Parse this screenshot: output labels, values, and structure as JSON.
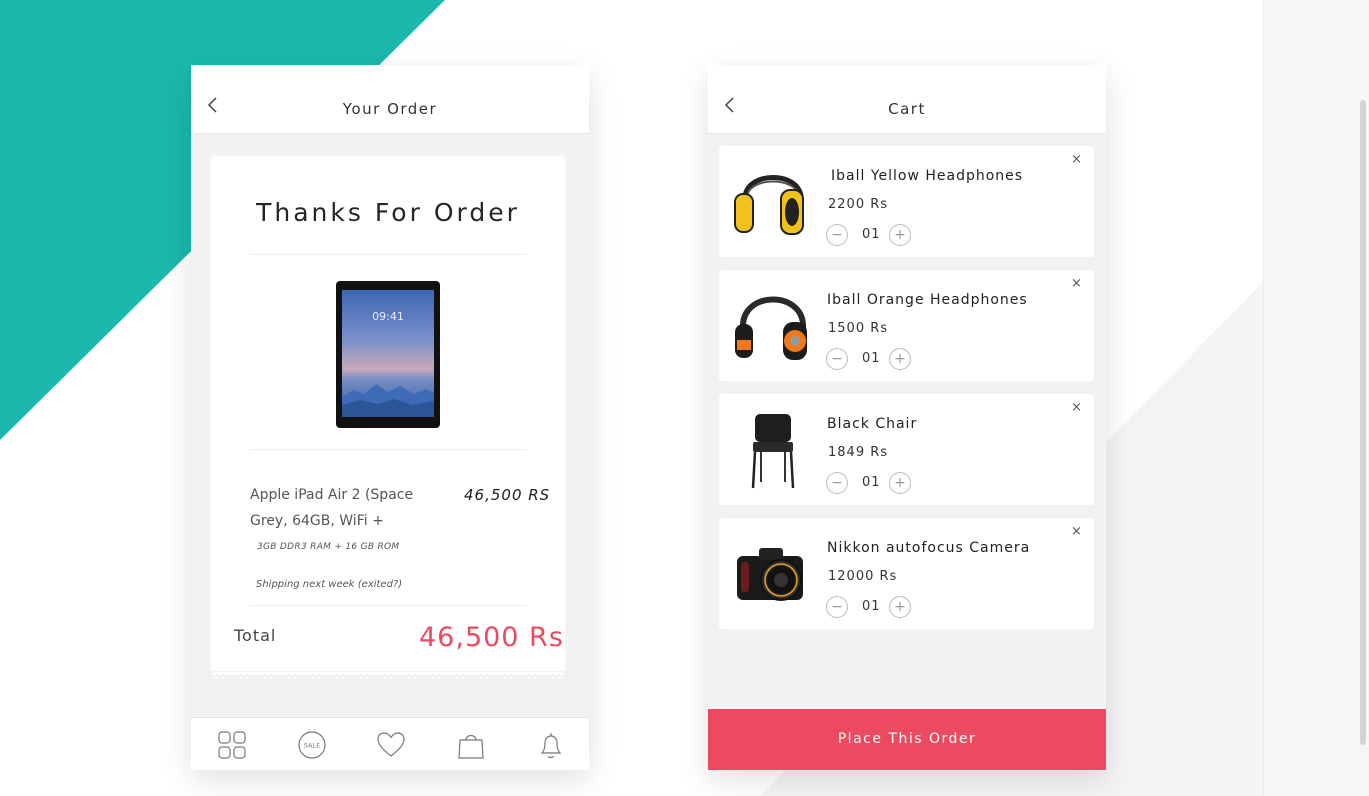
{
  "colors": {
    "teal": "#1ab8ad",
    "accent": "#eb4a60"
  },
  "order_screen": {
    "title": "Your Order",
    "back_icon": "chevron-left-icon",
    "heading": "Thanks For Order",
    "device_clock": "09:41",
    "product": {
      "name": "Apple iPad Air 2 (Space Grey, 64GB, WiFi +",
      "price": "46,500 RS",
      "spec": "3GB DDR3 RAM + 16 GB ROM",
      "shipping_note": "Shipping next week (exited?)"
    },
    "total_label": "Total",
    "total_value": "46,500 Rs",
    "nav": [
      {
        "icon": "grid-icon"
      },
      {
        "icon": "sale-icon",
        "label": "SALE"
      },
      {
        "icon": "heart-icon"
      },
      {
        "icon": "shopping-bag-icon"
      },
      {
        "icon": "bell-icon"
      }
    ]
  },
  "cart_screen": {
    "title": "Cart",
    "back_icon": "chevron-left-icon",
    "items": [
      {
        "name": "Iball Yellow Headphones",
        "price": "2200 Rs",
        "qty": "01",
        "remove": "×",
        "minus": "−",
        "plus": "+",
        "image": "yellow-headphones"
      },
      {
        "name": "Iball Orange Headphones",
        "price": "1500 Rs",
        "qty": "01",
        "remove": "×",
        "minus": "−",
        "plus": "+",
        "image": "orange-headphones"
      },
      {
        "name": "Black Chair",
        "price": "1849 Rs",
        "qty": "01",
        "remove": "×",
        "minus": "−",
        "plus": "+",
        "image": "black-chair"
      },
      {
        "name": "Nikkon autofocus Camera",
        "price": "12000 Rs",
        "qty": "01",
        "remove": "×",
        "minus": "−",
        "plus": "+",
        "image": "dslr-camera"
      }
    ],
    "place_order_label": "Place This Order"
  }
}
